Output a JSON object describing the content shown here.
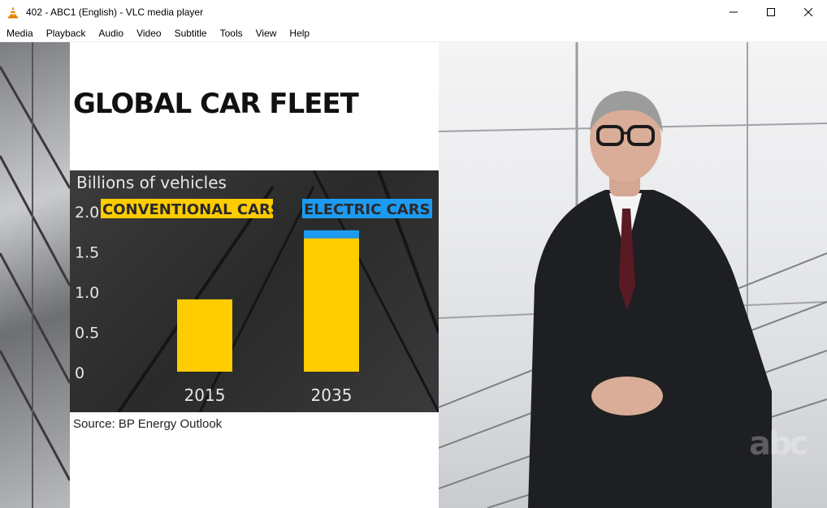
{
  "window": {
    "title": "402 - ABC1 (English) - VLC media player",
    "icon": "vlc-cone-icon",
    "controls": [
      "minimize-icon",
      "maximize-icon",
      "close-icon"
    ]
  },
  "menu": {
    "items": [
      "Media",
      "Playback",
      "Audio",
      "Video",
      "Subtitle",
      "Tools",
      "View",
      "Help"
    ]
  },
  "video_frame": {
    "headline": "GLOBAL CAR FLEET",
    "source": "Source: BP Energy Outlook",
    "watermark": "abc"
  },
  "chart_data": {
    "type": "bar",
    "ylabel": "Billions of vehicles",
    "categories": [
      "2015",
      "2035"
    ],
    "series": [
      {
        "name": "CONVENTIONAL CARS",
        "values": [
          0.9,
          1.66
        ],
        "color": "#ffcc00"
      },
      {
        "name": "ELECTRIC CARS",
        "values": [
          0.0,
          0.1
        ],
        "color": "#1e9bf0"
      }
    ],
    "ylim": [
      0,
      2.0
    ],
    "yticks": [
      "0",
      "0.5",
      "1.0",
      "1.5",
      "2.0"
    ],
    "legend_position": "top",
    "grid": false,
    "stacked": true,
    "label_bg_conventional": "#ffcc00",
    "label_bg_electric": "#1e9bf0"
  }
}
